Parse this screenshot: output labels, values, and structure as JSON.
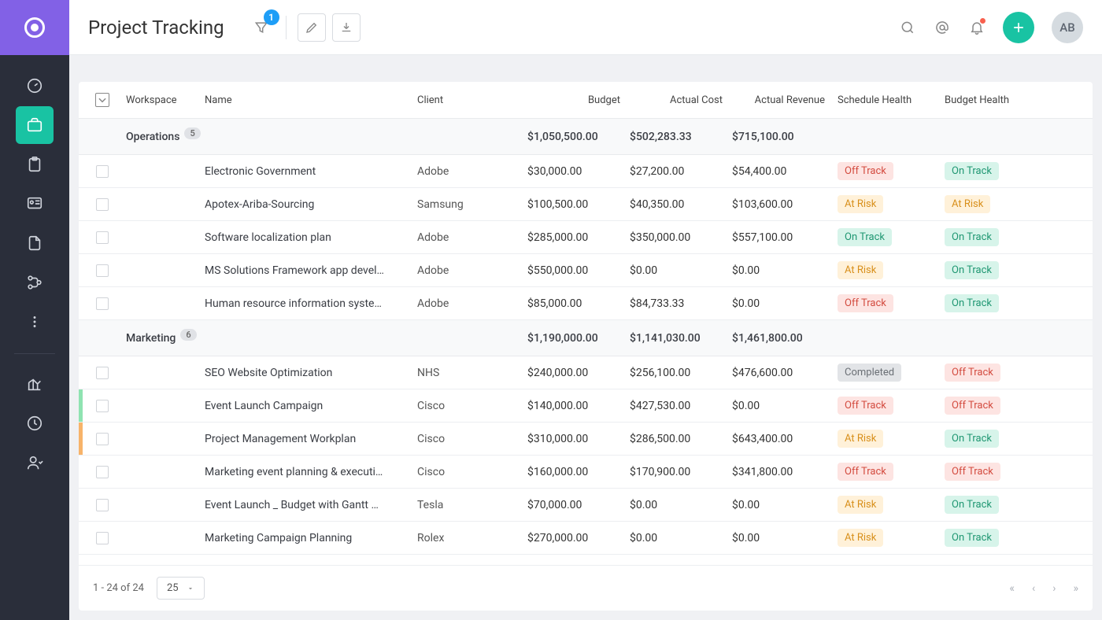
{
  "header": {
    "title": "Project Tracking",
    "filter_count": "1",
    "user_initials": "AB"
  },
  "tags": {
    "off_track": "Off Track",
    "at_risk": "At Risk",
    "on_track": "On Track",
    "completed": "Completed"
  },
  "table": {
    "columns": {
      "workspace": "Workspace",
      "name": "Name",
      "client": "Client",
      "budget": "Budget",
      "actual_cost": "Actual Cost",
      "actual_revenue": "Actual Revenue",
      "schedule_health": "Schedule Health",
      "budget_health": "Budget Health"
    },
    "groups": [
      {
        "name": "Operations",
        "count": 5,
        "totals": {
          "budget": "$1,050,500.00",
          "actual_cost": "$502,283.33",
          "actual_revenue": "$715,100.00"
        },
        "rows": [
          {
            "name": "Electronic Government",
            "client": "Adobe",
            "budget": "$30,000.00",
            "actual_cost": "$27,200.00",
            "actual_revenue": "$54,400.00",
            "schedule": "off_track",
            "budget_health": "on_track"
          },
          {
            "name": "Apotex-Ariba-Sourcing",
            "client": "Samsung",
            "budget": "$100,500.00",
            "actual_cost": "$40,350.00",
            "actual_revenue": "$103,600.00",
            "schedule": "at_risk",
            "budget_health": "at_risk"
          },
          {
            "name": "Software localization plan",
            "client": "Adobe",
            "budget": "$285,000.00",
            "actual_cost": "$350,000.00",
            "actual_revenue": "$557,100.00",
            "schedule": "on_track",
            "budget_health": "on_track"
          },
          {
            "name": "MS Solutions Framework app devel…",
            "client": "Adobe",
            "budget": "$550,000.00",
            "actual_cost": "$0.00",
            "actual_revenue": "$0.00",
            "schedule": "at_risk",
            "budget_health": "on_track"
          },
          {
            "name": "Human resource information syste…",
            "client": "Adobe",
            "budget": "$85,000.00",
            "actual_cost": "$84,733.33",
            "actual_revenue": "$0.00",
            "schedule": "off_track",
            "budget_health": "on_track"
          }
        ]
      },
      {
        "name": "Marketing",
        "count": 6,
        "totals": {
          "budget": "$1,190,000.00",
          "actual_cost": "$1,141,030.00",
          "actual_revenue": "$1,461,800.00"
        },
        "rows": [
          {
            "name": "SEO Website Optimization",
            "client": "NHS",
            "budget": "$240,000.00",
            "actual_cost": "$256,100.00",
            "actual_revenue": "$476,600.00",
            "schedule": "completed",
            "budget_health": "off_track"
          },
          {
            "name": "Event Launch Campaign",
            "client": "Cisco",
            "budget": "$140,000.00",
            "actual_cost": "$427,530.00",
            "actual_revenue": "$0.00",
            "schedule": "off_track",
            "budget_health": "off_track",
            "mark": "green"
          },
          {
            "name": "Project Management Workplan",
            "client": "Cisco",
            "budget": "$310,000.00",
            "actual_cost": "$286,500.00",
            "actual_revenue": "$643,400.00",
            "schedule": "at_risk",
            "budget_health": "on_track",
            "mark": "orange"
          },
          {
            "name": "Marketing event planning & executi…",
            "client": "Cisco",
            "budget": "$160,000.00",
            "actual_cost": "$170,900.00",
            "actual_revenue": "$341,800.00",
            "schedule": "off_track",
            "budget_health": "off_track"
          },
          {
            "name": "Event Launch _ Budget with Gantt …",
            "client": "Tesla",
            "budget": "$70,000.00",
            "actual_cost": "$0.00",
            "actual_revenue": "$0.00",
            "schedule": "at_risk",
            "budget_health": "on_track"
          },
          {
            "name": "Marketing Campaign Planning",
            "client": "Rolex",
            "budget": "$270,000.00",
            "actual_cost": "$0.00",
            "actual_revenue": "$0.00",
            "schedule": "at_risk",
            "budget_health": "on_track"
          }
        ]
      }
    ]
  },
  "pagination": {
    "info": "1 - 24 of 24",
    "page_size": "25"
  }
}
